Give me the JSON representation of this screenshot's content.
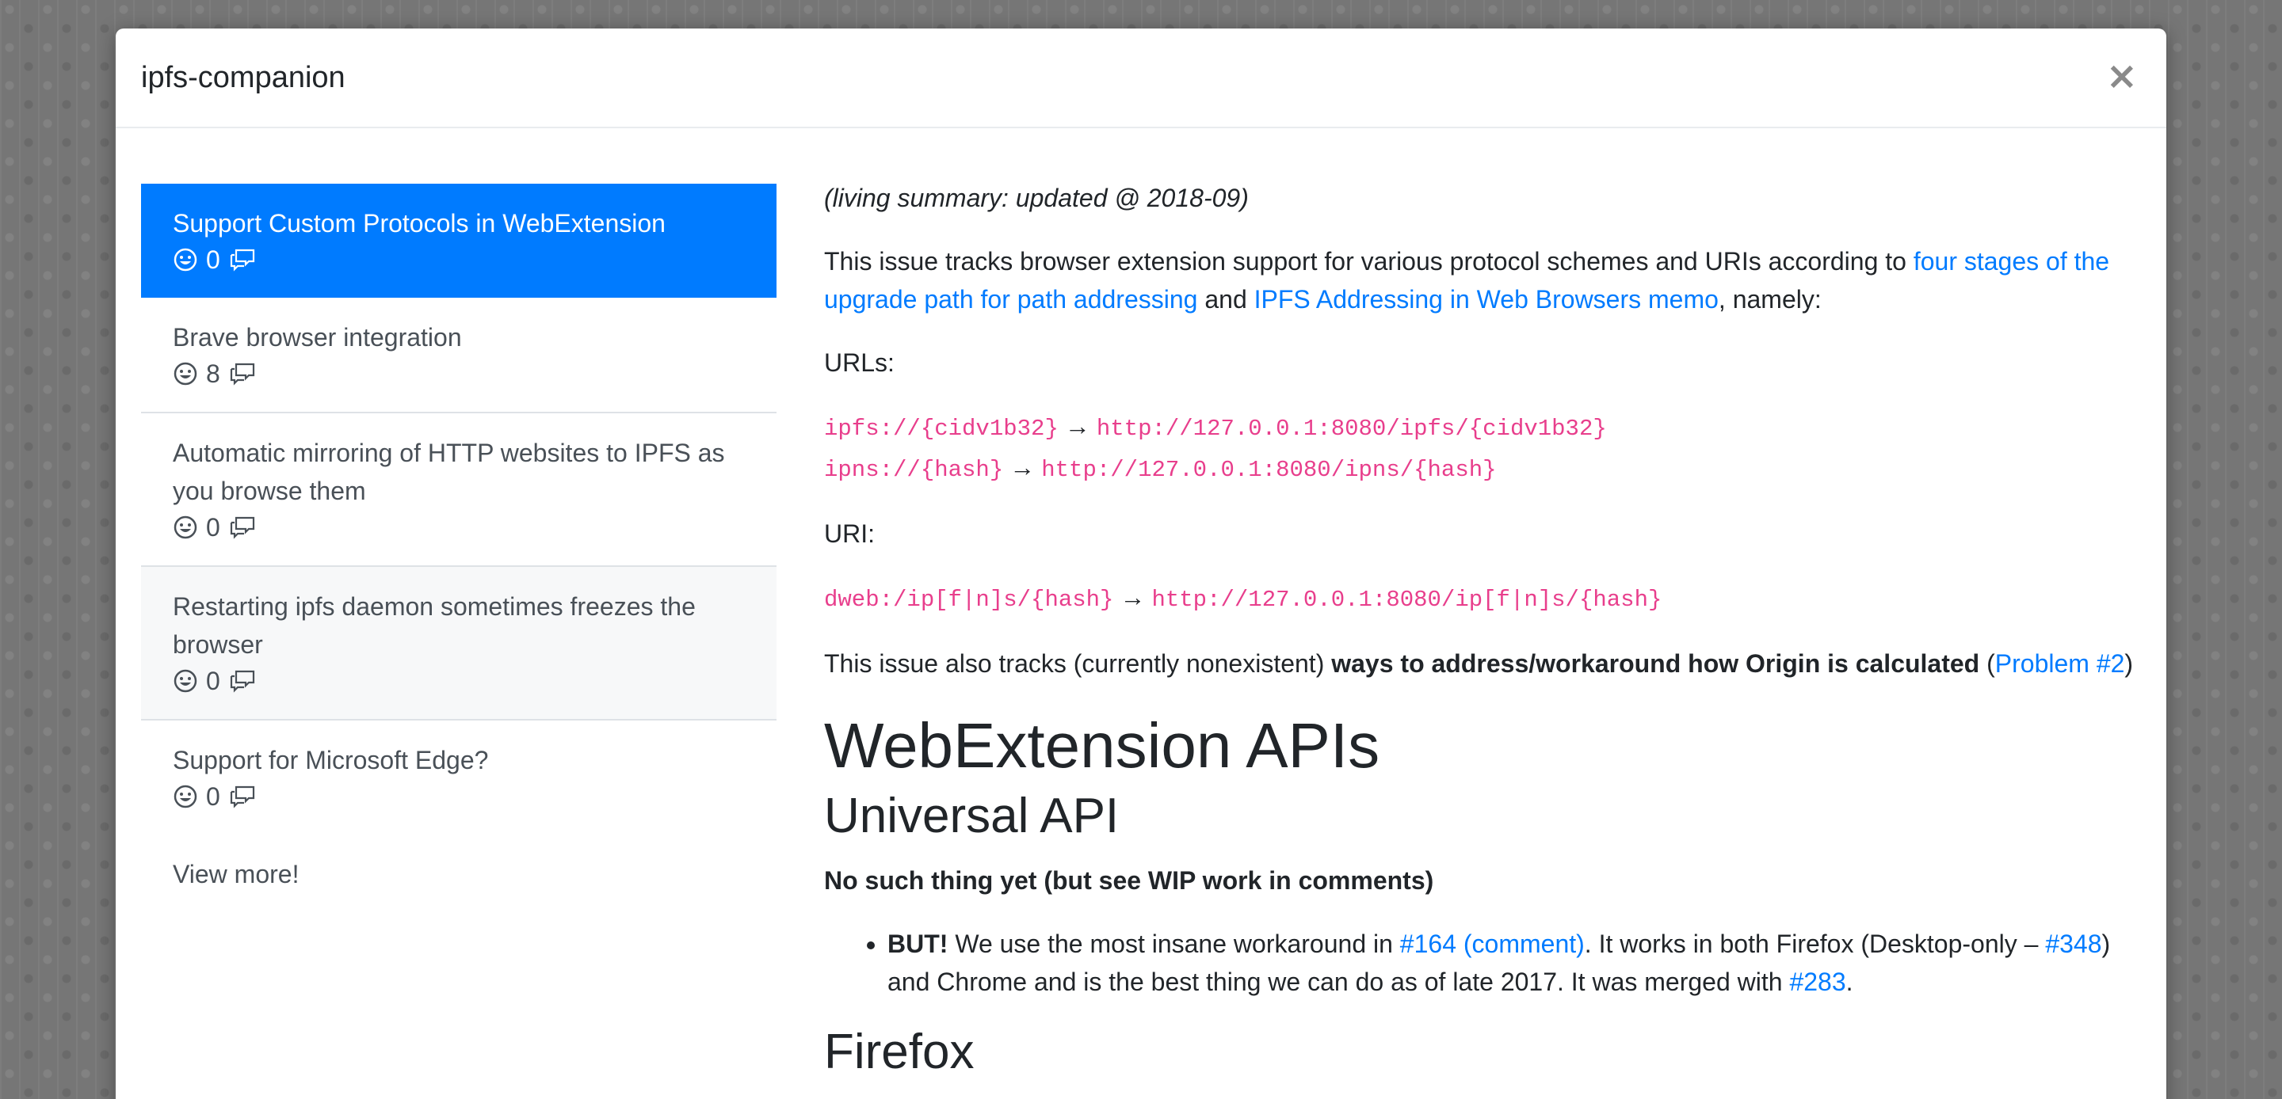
{
  "modal": {
    "title": "ipfs-companion",
    "close_label": "×"
  },
  "sidebar": {
    "items": [
      {
        "title": "Support Custom Protocols in WebExtension",
        "reactions": "0",
        "active": true
      },
      {
        "title": "Brave browser integration",
        "reactions": "8"
      },
      {
        "title": "Automatic mirroring of HTTP websites to IPFS as you browse them",
        "reactions": "0"
      },
      {
        "title": "Restarting ipfs daemon sometimes freezes the browser",
        "reactions": "0"
      },
      {
        "title": "Support for Microsoft Edge?",
        "reactions": "0"
      }
    ],
    "view_more": "View more!"
  },
  "content": {
    "summary": "(living summary: updated @ 2018-09)",
    "intro_pre": "This issue tracks browser extension support for various protocol schemes and URIs according to ",
    "intro_link1": "four stages of the upgrade path for path addressing",
    "intro_and": " and ",
    "intro_link2": "IPFS Addressing in Web Browsers memo",
    "intro_post": ", namely:",
    "urls_label": "URLs:",
    "url1_from": "ipfs://{cidv1b32}",
    "url1_to": "http://127.0.0.1:8080/ipfs/{cidv1b32}",
    "url2_from": "ipns://{hash}",
    "url2_to": "http://127.0.0.1:8080/ipns/{hash}",
    "arrow": "→",
    "uri_label": "URI:",
    "uri_from": "dweb:/ip[f|n]s/{hash}",
    "uri_to": "http://127.0.0.1:8080/ip[f|n]s/{hash}",
    "origin_pre": "This issue also tracks (currently nonexistent) ",
    "origin_bold": "ways to address/workaround how Origin is calculated",
    "origin_open": " (",
    "origin_link": "Problem #2",
    "origin_close": ")",
    "h1": "WebExtension APIs",
    "h2_universal": "Universal API",
    "no_such": "No such thing yet (but see WIP work in comments)",
    "bullet_bold": "BUT!",
    "bullet_pre": " We use the most insane workaround in ",
    "bullet_link1": "#164 (comment)",
    "bullet_mid": ". It works in both Firefox (Desktop-only – ",
    "bullet_link2": "#348",
    "bullet_mid2": ") and Chrome and is the best thing we can do as of late 2017. It was merged with ",
    "bullet_link3": "#283",
    "bullet_end": ".",
    "h2_firefox": "Firefox"
  },
  "colors": {
    "accent": "#007bff",
    "code": "#e83e8c",
    "text": "#212529"
  }
}
